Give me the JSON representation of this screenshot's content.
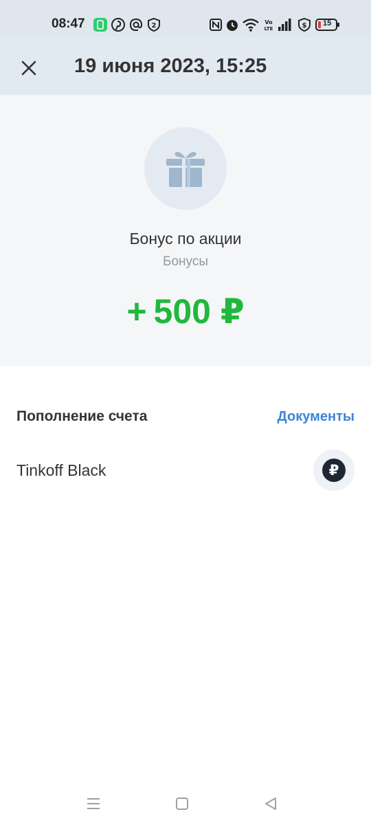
{
  "status_bar": {
    "time": "08:47",
    "battery_level": "15",
    "left_icons": [
      "app-notification-icon",
      "pinterest-icon",
      "at-icon",
      "2fa-shield-icon"
    ],
    "right_icons": [
      "nfc-icon",
      "alarm-icon",
      "wifi-icon",
      "volte-icon",
      "signal-icon",
      "vpn-shield-icon",
      "battery-icon"
    ]
  },
  "header": {
    "close_icon": "close-icon",
    "title": "19 июня 2023, 15:25"
  },
  "operation": {
    "icon": "gift-icon",
    "title": "Бонус по акции",
    "category": "Бонусы",
    "amount": "+ 500 ₽",
    "amount_color": "#1fb83c"
  },
  "details": {
    "section_title": "Пополнение счета",
    "documents_label": "Документы",
    "account_name": "Tinkoff Black",
    "account_icon": "ruble-icon",
    "account_icon_symbol": "₽"
  },
  "colors": {
    "header_bg": "#e1e9f1",
    "link": "#3d85d8",
    "positive": "#1fb83c"
  },
  "nav_bar": {
    "icons": [
      "menu-icon",
      "home-icon",
      "back-icon"
    ]
  }
}
